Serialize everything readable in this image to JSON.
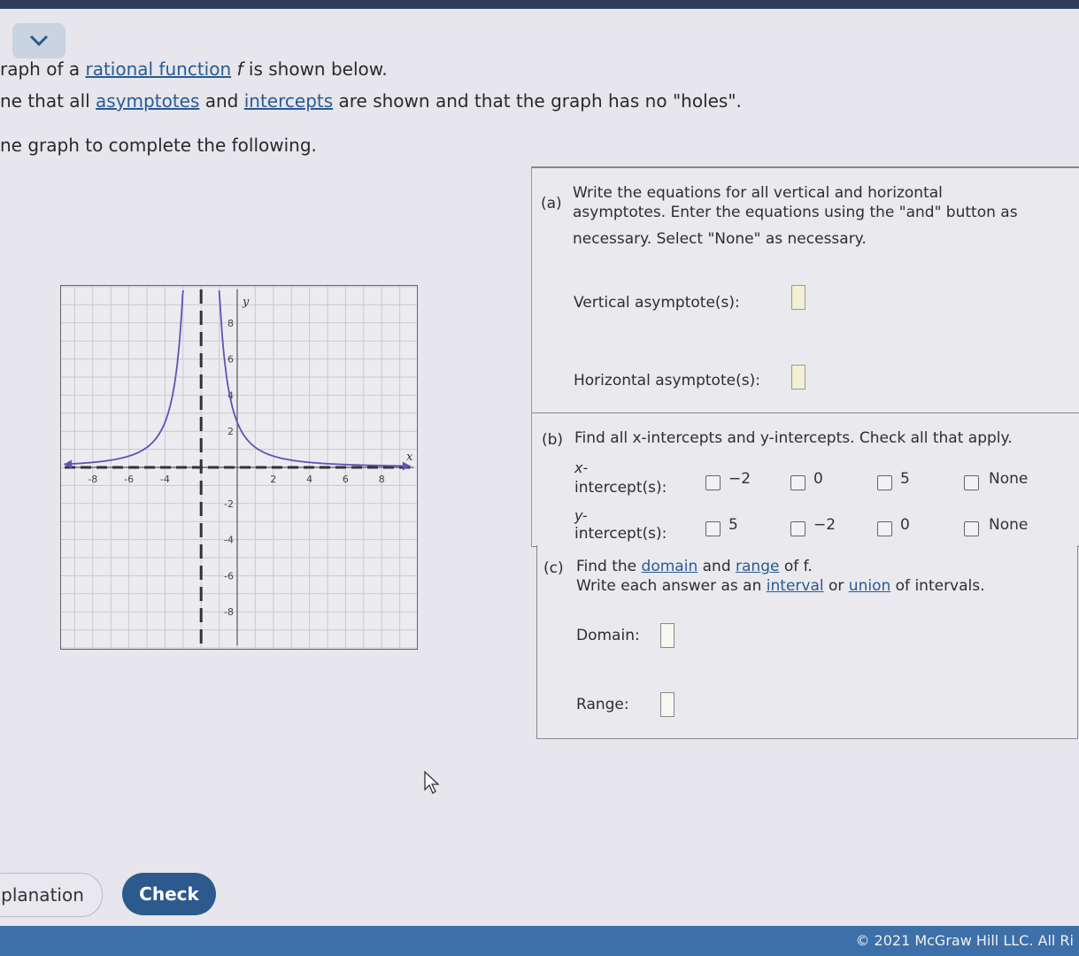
{
  "prompt": {
    "line1_a": "raph of a ",
    "line1_link": "rational function",
    "line1_f": " f",
    "line1_b": " is shown below.",
    "line2_a": "ne that all ",
    "line2_link1": "asymptotes",
    "line2_mid": " and ",
    "line2_link2": "intercepts",
    "line2_b": " are shown and that the graph has no \"holes\".",
    "line3": "ne graph to complete the following."
  },
  "part_a": {
    "label": "(a)",
    "instructions_1": "Write the equations for all vertical and horizontal",
    "instructions_2": "asymptotes. Enter the equations using the \"and\" button as",
    "instructions_3": "necessary. Select \"None\" as necessary.",
    "vertical_label": "Vertical asymptote(s):",
    "horizontal_label": "Horizontal asymptote(s):"
  },
  "part_b": {
    "label": "(b)",
    "instructions": "Find all x-intercepts and y-intercepts. Check all that apply.",
    "x_label_1": "x-",
    "x_label_2": "intercept(s):",
    "x_options": [
      "−2",
      "0",
      "5",
      "None"
    ],
    "y_label_1": "y-",
    "y_label_2": "intercept(s):",
    "y_options": [
      "5",
      "−2",
      "0",
      "None"
    ]
  },
  "part_c": {
    "label": "(c)",
    "line1_a": "Find the ",
    "line1_link1": "domain",
    "line1_mid": " and ",
    "line1_link2": "range",
    "line1_b": " of f.",
    "line2_a": "Write each answer as an ",
    "line2_link1": "interval",
    "line2_mid": " or ",
    "line2_link2": "union",
    "line2_b": " of intervals.",
    "domain_label": "Domain:",
    "range_label": "Range:"
  },
  "graph": {
    "x_axis_label": "x",
    "y_axis_label": "y",
    "x_ticks": [
      "-8",
      "-6",
      "-4",
      "2",
      "4",
      "6",
      "8"
    ],
    "y_ticks": [
      "8",
      "6",
      "4",
      "2",
      "-2",
      "-4",
      "-6",
      "-8"
    ],
    "vertical_asymptote_x": -2,
    "horizontal_asymptote_y": 0,
    "curve_color": "#5a55b5"
  },
  "buttons": {
    "explanation": "planation",
    "check": "Check"
  },
  "footer": "© 2021 McGraw Hill LLC. All Ri",
  "colors": {
    "accent": "#2c5a8c",
    "footer": "#3d6fa8",
    "link": "#2a5a94"
  }
}
